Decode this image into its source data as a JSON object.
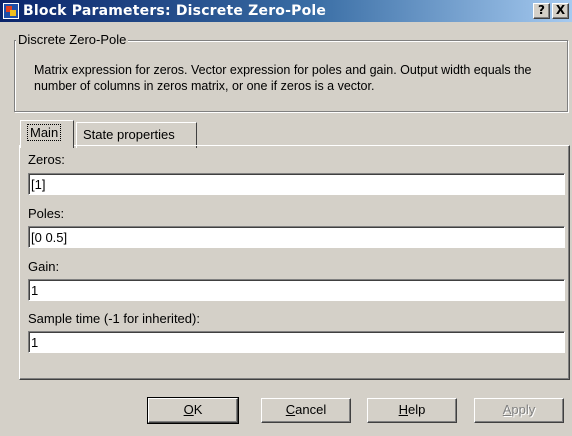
{
  "window": {
    "title": "Block Parameters: Discrete Zero-Pole",
    "help_label": "?",
    "close_label": "X"
  },
  "group": {
    "legend": "Discrete Zero-Pole",
    "description": "Matrix expression for zeros.  Vector expression for poles and gain. Output width equals the number of columns in zeros matrix, or one if zeros is a vector."
  },
  "tabs": [
    {
      "label": "Main",
      "selected": true
    },
    {
      "label": "State properties",
      "selected": false
    }
  ],
  "fields": {
    "zeros": {
      "label": "Zeros:",
      "value": "[1]"
    },
    "poles": {
      "label": "Poles:",
      "value": "[0 0.5]"
    },
    "gain": {
      "label": "Gain:",
      "value": "1"
    },
    "sample_time": {
      "label": "Sample time (-1 for inherited):",
      "value": "1"
    }
  },
  "buttons": {
    "ok": {
      "first": "O",
      "rest": "K"
    },
    "cancel": {
      "first": "C",
      "rest": "ancel"
    },
    "help": {
      "first": "H",
      "rest": "elp"
    },
    "apply": {
      "first": "A",
      "rest": "pply"
    }
  },
  "icons": [
    "app-icon",
    "help-icon",
    "close-icon"
  ]
}
